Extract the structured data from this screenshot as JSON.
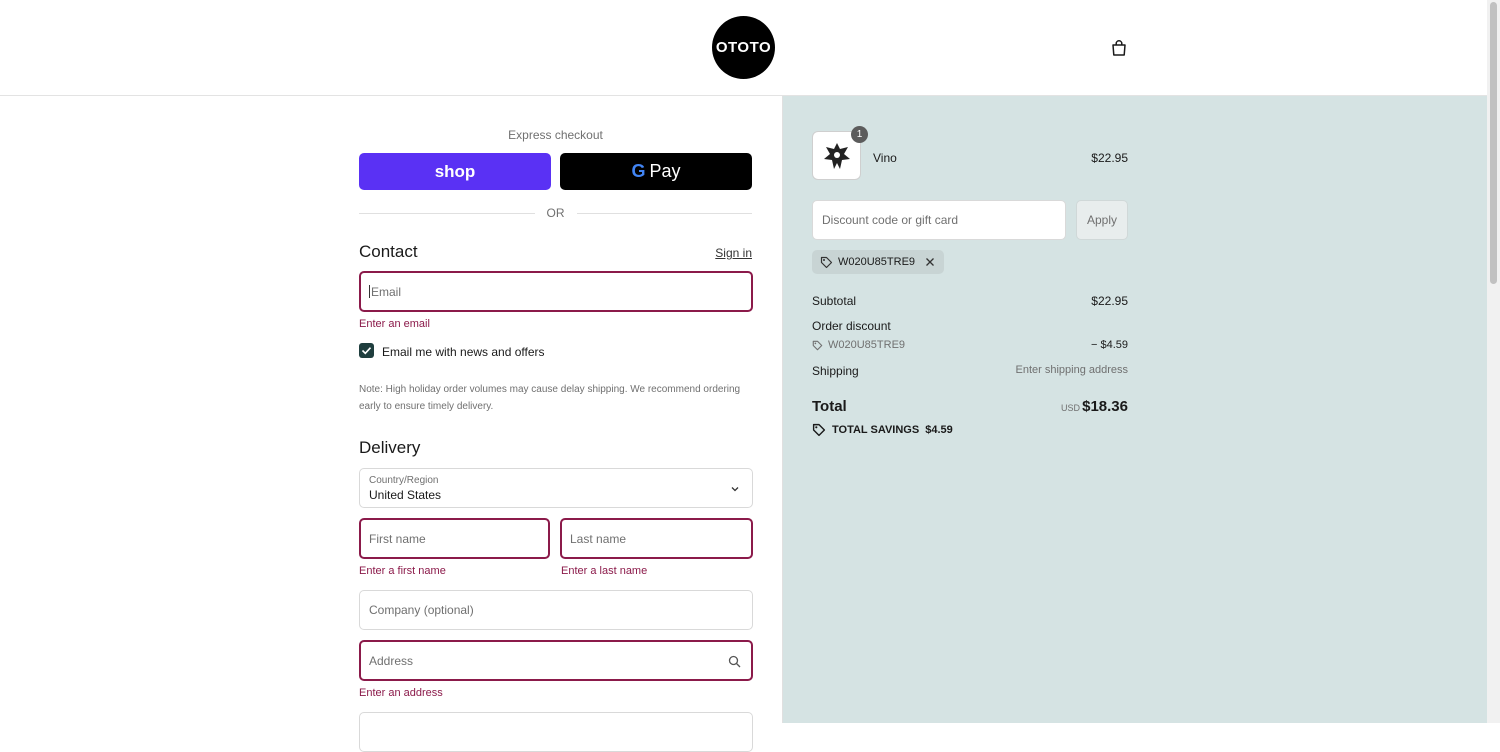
{
  "header": {
    "logo_text": "OTOTO",
    "cart_icon": "shopping-bag-icon"
  },
  "express": {
    "label": "Express checkout",
    "shop_label": "shop",
    "gpay_g": "G",
    "gpay_label": "Pay",
    "or_label": "OR"
  },
  "contact": {
    "title": "Contact",
    "sign_in": "Sign in",
    "email_placeholder": "Email",
    "email_error": "Enter an email",
    "newsletter_label": "Email me with news and offers",
    "newsletter_checked": true,
    "note": "Note: High holiday order volumes may cause delay shipping. We recommend ordering early to ensure timely delivery."
  },
  "delivery": {
    "title": "Delivery",
    "country_label": "Country/Region",
    "country_value": "United States",
    "first_name_placeholder": "First name",
    "first_name_error": "Enter a first name",
    "last_name_placeholder": "Last name",
    "last_name_error": "Enter a last name",
    "company_placeholder": "Company (optional)",
    "address_placeholder": "Address",
    "address_error": "Enter an address"
  },
  "summary": {
    "product": {
      "name": "Vino",
      "price": "$22.95",
      "quantity": "1"
    },
    "discount_placeholder": "Discount code or gift card",
    "apply_label": "Apply",
    "applied_code": "W020U85TRE9",
    "subtotal_label": "Subtotal",
    "subtotal_value": "$22.95",
    "order_discount_label": "Order discount",
    "order_discount_code": "W020U85TRE9",
    "order_discount_value": "− $4.59",
    "shipping_label": "Shipping",
    "shipping_value": "Enter shipping address",
    "total_label": "Total",
    "total_currency": "USD",
    "total_value": "$18.36",
    "savings_label": "TOTAL SAVINGS",
    "savings_value": "$4.59"
  },
  "colors": {
    "accent_error": "#8b1a4a",
    "shop_pay": "#5a31f4",
    "summary_bg": "#d5e3e3",
    "checkbox": "#1f3e3e"
  }
}
